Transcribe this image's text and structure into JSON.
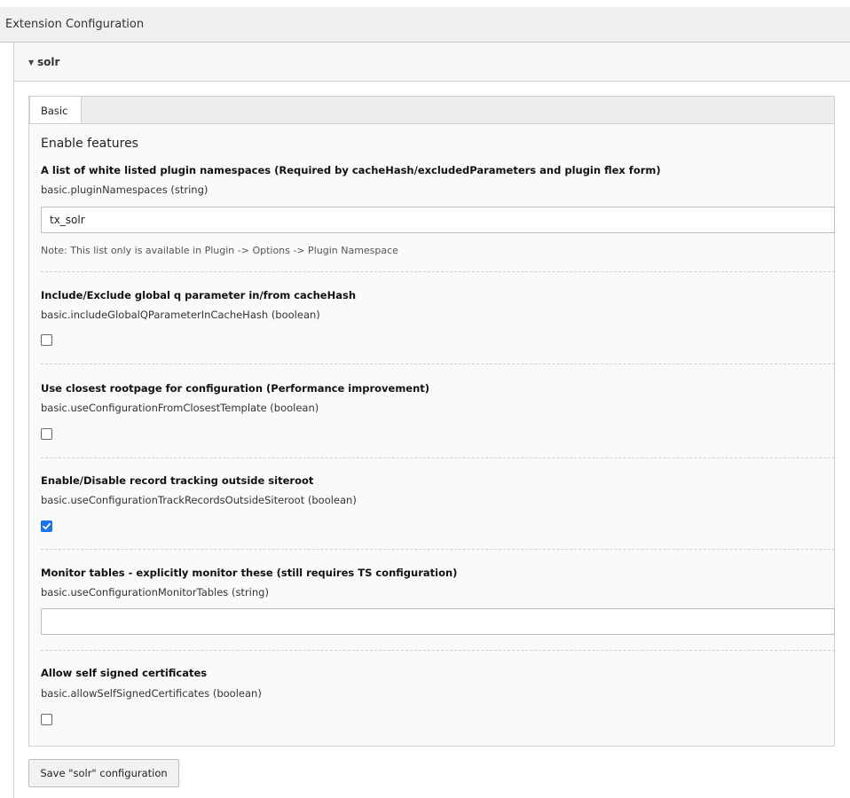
{
  "header": {
    "title": "Extension Configuration"
  },
  "panel": {
    "title": "solr"
  },
  "tabs": [
    {
      "label": "Basic"
    }
  ],
  "section": {
    "title": "Enable features"
  },
  "fields": {
    "plugin_namespaces": {
      "label": "A list of white listed plugin namespaces (Required by cacheHash/excludedParameters and plugin flex form)",
      "key": "basic.pluginNamespaces (string)",
      "value": "tx_solr",
      "note": "Note: This list only is available in Plugin -> Options -> Plugin Namespace"
    },
    "include_global_q": {
      "label": "Include/Exclude global q parameter in/from cacheHash",
      "key": "basic.includeGlobalQParameterInCacheHash (boolean)",
      "checked": false
    },
    "closest_rootpage": {
      "label": "Use closest rootpage for configuration (Performance improvement)",
      "key": "basic.useConfigurationFromClosestTemplate (boolean)",
      "checked": false
    },
    "record_tracking": {
      "label": "Enable/Disable record tracking outside siteroot",
      "key": "basic.useConfigurationTrackRecordsOutsideSiteroot (boolean)",
      "checked": true
    },
    "monitor_tables": {
      "label": "Monitor tables - explicitly monitor these (still requires TS configuration)",
      "key": "basic.useConfigurationMonitorTables (string)",
      "value": ""
    },
    "self_signed": {
      "label": "Allow self signed certificates",
      "key": "basic.allowSelfSignedCertificates (boolean)",
      "checked": false
    }
  },
  "save_button": {
    "label": "Save \"solr\" configuration"
  },
  "colors": {
    "accent": "#1a73e8",
    "header_bg": "#f0f0f0",
    "panel_bg": "#fafafa"
  }
}
